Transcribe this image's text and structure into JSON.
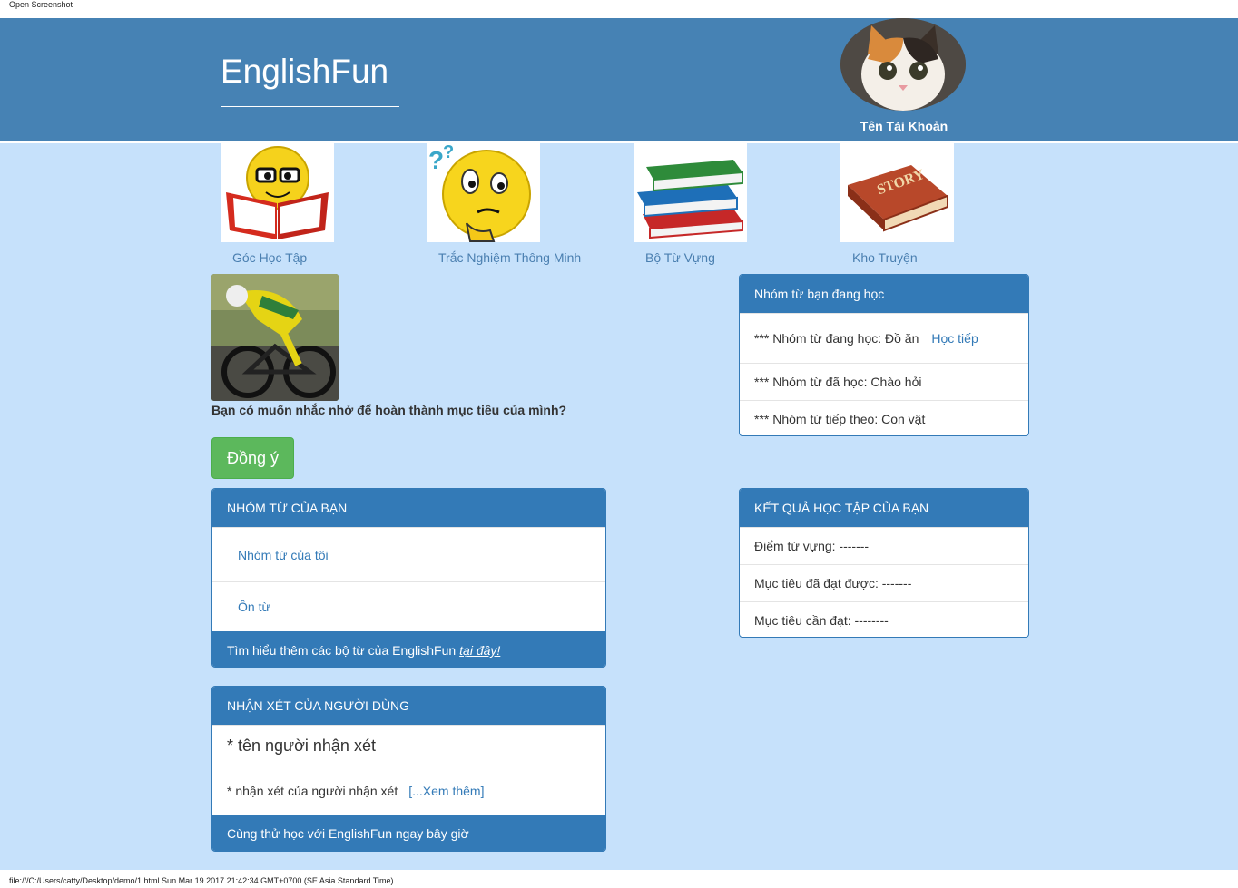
{
  "top_caption": "Open Screenshot",
  "brand": "EnglishFun",
  "account": {
    "name": "Tên Tài Khoản"
  },
  "features": [
    {
      "label": "Góc Học Tập",
      "icon": "reading-emoji-icon"
    },
    {
      "label": "Trắc Nghiệm Thông Minh",
      "icon": "thinking-emoji-icon"
    },
    {
      "label": "Bộ Từ Vựng",
      "icon": "book-stack-icon"
    },
    {
      "label": "Kho Truyện",
      "icon": "story-book-icon"
    }
  ],
  "reminder": {
    "question": "Bạn có muốn nhắc nhở để hoàn thành mục tiêu của mình?",
    "button": "Đồng ý"
  },
  "learning_panel": {
    "title": "Nhóm từ bạn đang học",
    "current": "*** Nhóm từ đang học: Đồ ăn",
    "continue_link": "Học tiếp",
    "done": "*** Nhóm từ đã học: Chào hỏi",
    "next": "*** Nhóm từ tiếp theo: Con vật"
  },
  "groups_panel": {
    "title": "NHÓM TỪ CỦA BẠN",
    "items": [
      "Nhóm từ của tôi",
      "Ôn từ"
    ],
    "footer_text": "Tìm hiểu thêm các bộ từ của EnglishFun ",
    "footer_link": "tại đây!"
  },
  "results_panel": {
    "title": "KẾT QUẢ HỌC TẬP CỦA BẠN",
    "rows": [
      "Điểm từ vựng: -------",
      "Mục tiêu đã đạt được: -------",
      "Mục tiêu cần đạt: --------"
    ]
  },
  "reviews_panel": {
    "title": "NHẬN XÉT CỦA NGƯỜI DÙNG",
    "reviewer": "* tên người nhận xét",
    "comment": "* nhận xét của người nhận xét",
    "more_link": "[...Xem thêm]",
    "footer": "Cùng thử học với EnglishFun ngay bây giờ"
  },
  "footer_caption": "file:///C:/Users/catty/Desktop/demo/1.html Sun Mar 19 2017 21:42:34 GMT+0700 (SE Asia Standard Time)",
  "colors": {
    "header": "#4682b4",
    "background": "#c6e1fb",
    "panel": "#337ab7",
    "success": "#5cb85c"
  }
}
